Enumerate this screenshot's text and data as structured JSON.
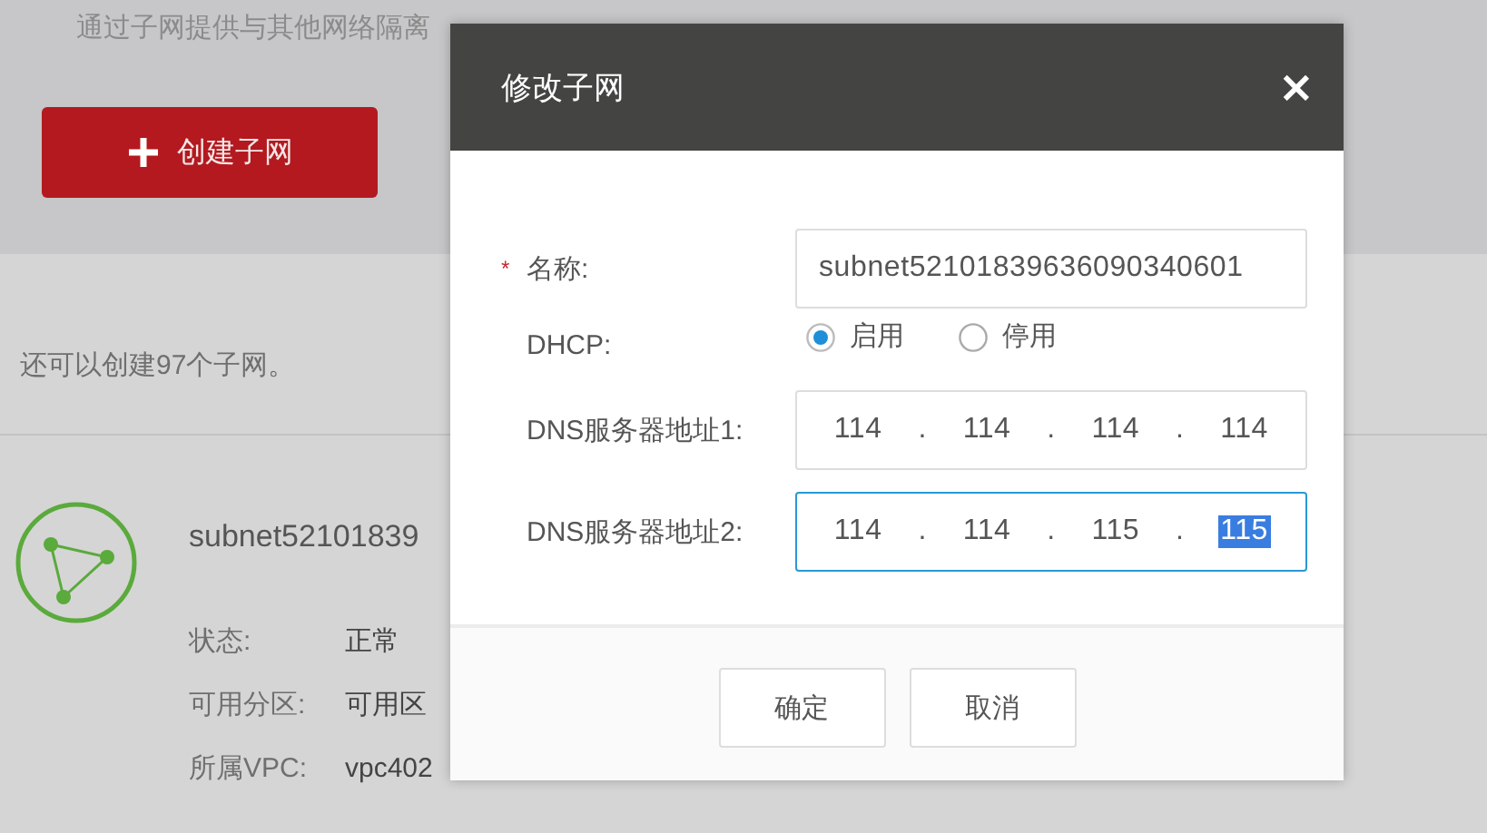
{
  "page": {
    "intro": "通过子网提供与其他网络隔离",
    "create_button": "创建子网",
    "quota": "还可以创建97个子网。",
    "subnet": {
      "name": "subnet52101839",
      "props": [
        {
          "label": "状态:",
          "value": "正常"
        },
        {
          "label": "可用分区:",
          "value": "可用区"
        },
        {
          "label": "所属VPC:",
          "value": "vpc402"
        }
      ]
    }
  },
  "dialog": {
    "title": "修改子网",
    "close": "×",
    "name_field": {
      "label": "名称:",
      "required_mark": "*",
      "value": "subnet52101839636090340601"
    },
    "dhcp": {
      "label": "DHCP:",
      "options": [
        {
          "label": "启用",
          "selected": true
        },
        {
          "label": "停用",
          "selected": false
        }
      ]
    },
    "dns_fields": [
      {
        "label": "DNS服务器地址1:",
        "separator": ".",
        "focused": false,
        "octets": [
          {
            "value": "114",
            "selected": false
          },
          {
            "value": "114",
            "selected": false
          },
          {
            "value": "114",
            "selected": false
          },
          {
            "value": "114",
            "selected": false
          }
        ]
      },
      {
        "label": "DNS服务器地址2:",
        "separator": ".",
        "focused": true,
        "octets": [
          {
            "value": "114",
            "selected": false
          },
          {
            "value": "114",
            "selected": false
          },
          {
            "value": "115",
            "selected": false
          },
          {
            "value": "115",
            "selected": true
          }
        ]
      }
    ],
    "buttons": [
      "确定",
      "取消"
    ]
  }
}
